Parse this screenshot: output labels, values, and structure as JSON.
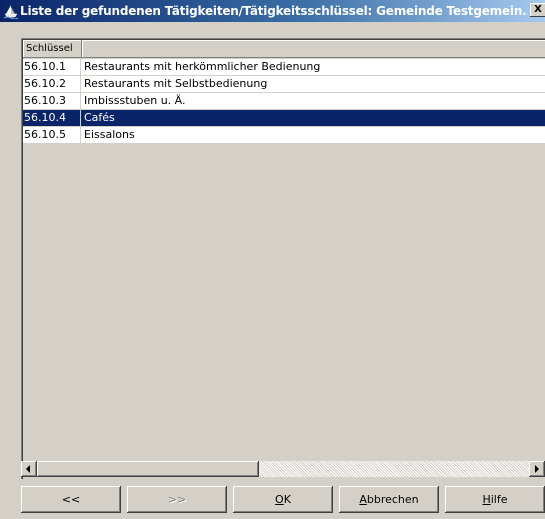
{
  "window": {
    "title": "Liste der gefundenen Tätigkeiten/Tätigkeitsschlüssel: Gemeinde Testgemein...",
    "close_label": "X"
  },
  "table": {
    "columns": [
      "Schlüssel",
      ""
    ],
    "rows": [
      {
        "key": "56.10.1",
        "label": "Restaurants mit herkömmlicher Bedienung",
        "selected": false
      },
      {
        "key": "56.10.2",
        "label": "Restaurants mit Selbstbedienung",
        "selected": false
      },
      {
        "key": "56.10.3",
        "label": "Imbissstuben u. Ä.",
        "selected": false
      },
      {
        "key": "56.10.4",
        "label": "Cafés",
        "selected": true
      },
      {
        "key": "56.10.5",
        "label": "Eissalons",
        "selected": false
      }
    ],
    "selection_color": "#0a246a"
  },
  "buttons": {
    "prev": "<<",
    "next": ">>",
    "ok_mnemonic": "O",
    "ok_rest": "K",
    "cancel_mnemonic": "A",
    "cancel_rest": "bbrechen",
    "help_mnemonic": "H",
    "help_rest": "ilfe"
  },
  "icons": {
    "app": "ship-icon",
    "close": "close-icon",
    "scroll_left": "arrow-left-icon",
    "scroll_right": "arrow-right-icon"
  }
}
